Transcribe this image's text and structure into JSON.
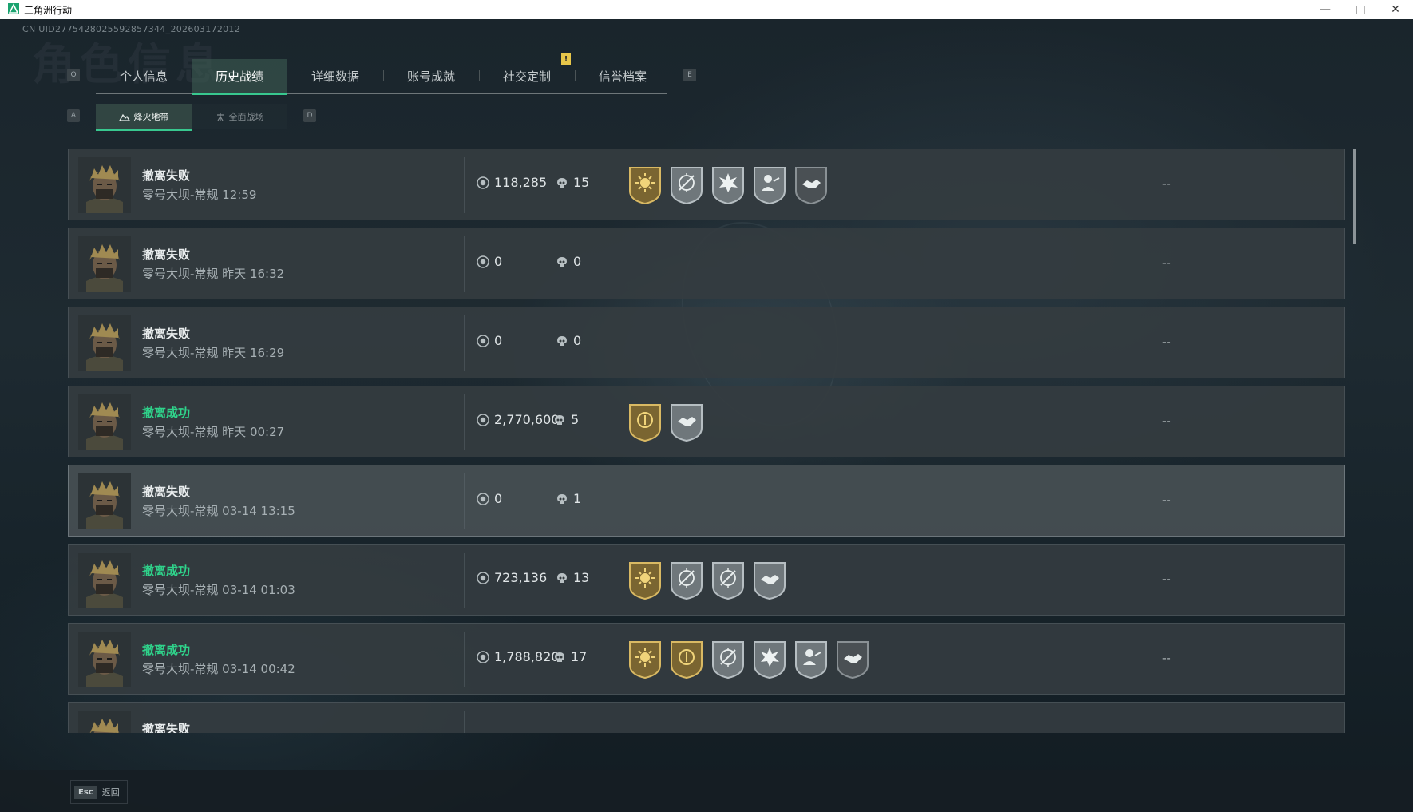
{
  "window": {
    "title": "三角洲行动",
    "accent": "#1aa36f"
  },
  "uid": "CN UID2775428025592857344_202603172012",
  "page_title_watermark": "角色信息",
  "tabs": {
    "left_key": "Q",
    "right_key": "E",
    "badge": "!",
    "items": [
      {
        "label": "个人信息",
        "active": false
      },
      {
        "label": "历史战绩",
        "active": true
      },
      {
        "label": "详细数据",
        "active": false
      },
      {
        "label": "账号成就",
        "active": false
      },
      {
        "label": "社交定制",
        "active": false
      },
      {
        "label": "信誉档案",
        "active": false
      }
    ]
  },
  "subtabs": {
    "left_key": "A",
    "right_key": "D",
    "items": [
      {
        "label": "烽火地带",
        "icon": "mountain-icon",
        "active": true
      },
      {
        "label": "全面战场",
        "icon": "tower-icon",
        "active": false
      }
    ]
  },
  "colors": {
    "success": "#2fd38b",
    "gold_medal": "#b89a4a",
    "silver_medal": "#8e979b",
    "dark_medal": "#5f666a"
  },
  "matches": [
    {
      "result": "撤离失败",
      "success": false,
      "map_time": "零号大坝-常规 12:59",
      "value": "118,285",
      "kills": "15",
      "medals": [
        {
          "tier": "gold",
          "icon": "sun-badge-icon"
        },
        {
          "tier": "silver",
          "icon": "crosshair-badge-icon"
        },
        {
          "tier": "silver",
          "icon": "explosion-badge-icon"
        },
        {
          "tier": "silver",
          "icon": "soldier-badge-icon"
        },
        {
          "tier": "dark",
          "icon": "handshake-badge-icon"
        }
      ],
      "extra": "--",
      "highlight": false
    },
    {
      "result": "撤离失败",
      "success": false,
      "map_time": "零号大坝-常规 昨天 16:32",
      "value": "0",
      "kills": "0",
      "medals": [],
      "extra": "--",
      "highlight": false
    },
    {
      "result": "撤离失败",
      "success": false,
      "map_time": "零号大坝-常规 昨天 16:29",
      "value": "0",
      "kills": "0",
      "medals": [],
      "extra": "--",
      "highlight": false
    },
    {
      "result": "撤离成功",
      "success": true,
      "map_time": "零号大坝-常规 昨天 00:27",
      "value": "2,770,600",
      "kills": "5",
      "medals": [
        {
          "tier": "gold",
          "icon": "coin-badge-icon"
        },
        {
          "tier": "silver",
          "icon": "handshake-badge-icon"
        }
      ],
      "extra": "--",
      "highlight": false
    },
    {
      "result": "撤离失败",
      "success": false,
      "map_time": "零号大坝-常规 03-14 13:15",
      "value": "0",
      "kills": "1",
      "medals": [],
      "extra": "--",
      "highlight": true
    },
    {
      "result": "撤离成功",
      "success": true,
      "map_time": "零号大坝-常规 03-14 01:03",
      "value": "723,136",
      "kills": "13",
      "medals": [
        {
          "tier": "gold",
          "icon": "sun-badge-icon"
        },
        {
          "tier": "silver",
          "icon": "crosshair-badge-icon"
        },
        {
          "tier": "silver",
          "icon": "crosshair-badge-icon"
        },
        {
          "tier": "silver",
          "icon": "handshake-badge-icon"
        }
      ],
      "extra": "--",
      "highlight": false
    },
    {
      "result": "撤离成功",
      "success": true,
      "map_time": "零号大坝-常规 03-14 00:42",
      "value": "1,788,820",
      "kills": "17",
      "medals": [
        {
          "tier": "gold",
          "icon": "sun-badge-icon"
        },
        {
          "tier": "gold",
          "icon": "coin-badge-icon"
        },
        {
          "tier": "silver",
          "icon": "crosshair-badge-icon"
        },
        {
          "tier": "silver",
          "icon": "explosion-badge-icon"
        },
        {
          "tier": "silver",
          "icon": "soldier-badge-icon"
        },
        {
          "tier": "dark",
          "icon": "handshake-badge-icon"
        }
      ],
      "extra": "--",
      "highlight": false
    },
    {
      "result": "撤离失败",
      "success": false,
      "map_time": "",
      "value": "",
      "kills": "",
      "medals": [],
      "extra": "",
      "highlight": false
    }
  ],
  "footer": {
    "esc_key": "Esc",
    "back_label": "返回"
  }
}
